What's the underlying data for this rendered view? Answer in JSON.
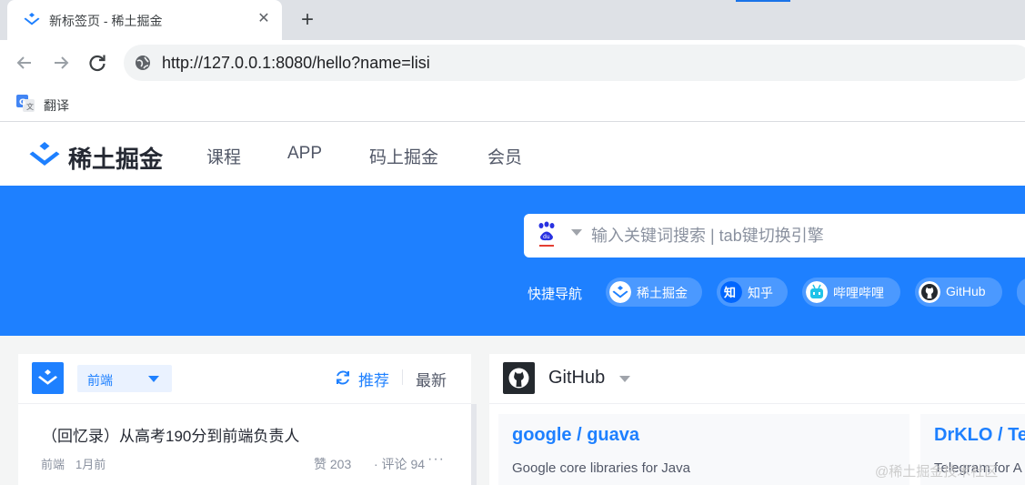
{
  "browser": {
    "tab": {
      "title": "新标签页 - 稀土掘金",
      "close": "✕"
    },
    "new_tab": "+",
    "url": "http://127.0.0.1:8080/hello?name=lisi",
    "bookmarks": [
      {
        "label": "翻译",
        "icon": "google-translate-icon"
      }
    ]
  },
  "header": {
    "logo_text": "稀土掘金",
    "nav": [
      "课程",
      "APP",
      "码上掘金",
      "会员"
    ]
  },
  "hero": {
    "search_placeholder": "输入关键词搜索 | tab键切换引擎",
    "search_engine_icon": "baidu-icon",
    "quick_nav_label": "快捷导航",
    "quick_nav": [
      {
        "label": "稀土掘金",
        "icon": "juejin-icon"
      },
      {
        "label": "知乎",
        "icon": "zhihu-icon"
      },
      {
        "label": "哔哩哔哩",
        "icon": "bilibili-icon"
      },
      {
        "label": "GitHub",
        "icon": "github-icon"
      }
    ]
  },
  "feed": {
    "category": "前端",
    "tab_recommend": "推荐",
    "tab_latest": "最新",
    "articles": [
      {
        "title": "（回忆录）从高考190分到前端负责人",
        "category": "前端",
        "time": "1月前",
        "likes": "赞 203",
        "comments": "· 评论 94",
        "more": "···"
      }
    ]
  },
  "github": {
    "title": "GitHub",
    "repos": [
      {
        "name": "google / guava",
        "description": "Google core libraries for Java"
      },
      {
        "name": "DrKLO / Te",
        "description": "Telegram for A"
      }
    ]
  },
  "watermark": "@稀土掘金技术社区",
  "colors": {
    "accent": "#1e80ff",
    "text": "#252933",
    "muted": "#8a919f",
    "chrome": "#dee1e6"
  }
}
